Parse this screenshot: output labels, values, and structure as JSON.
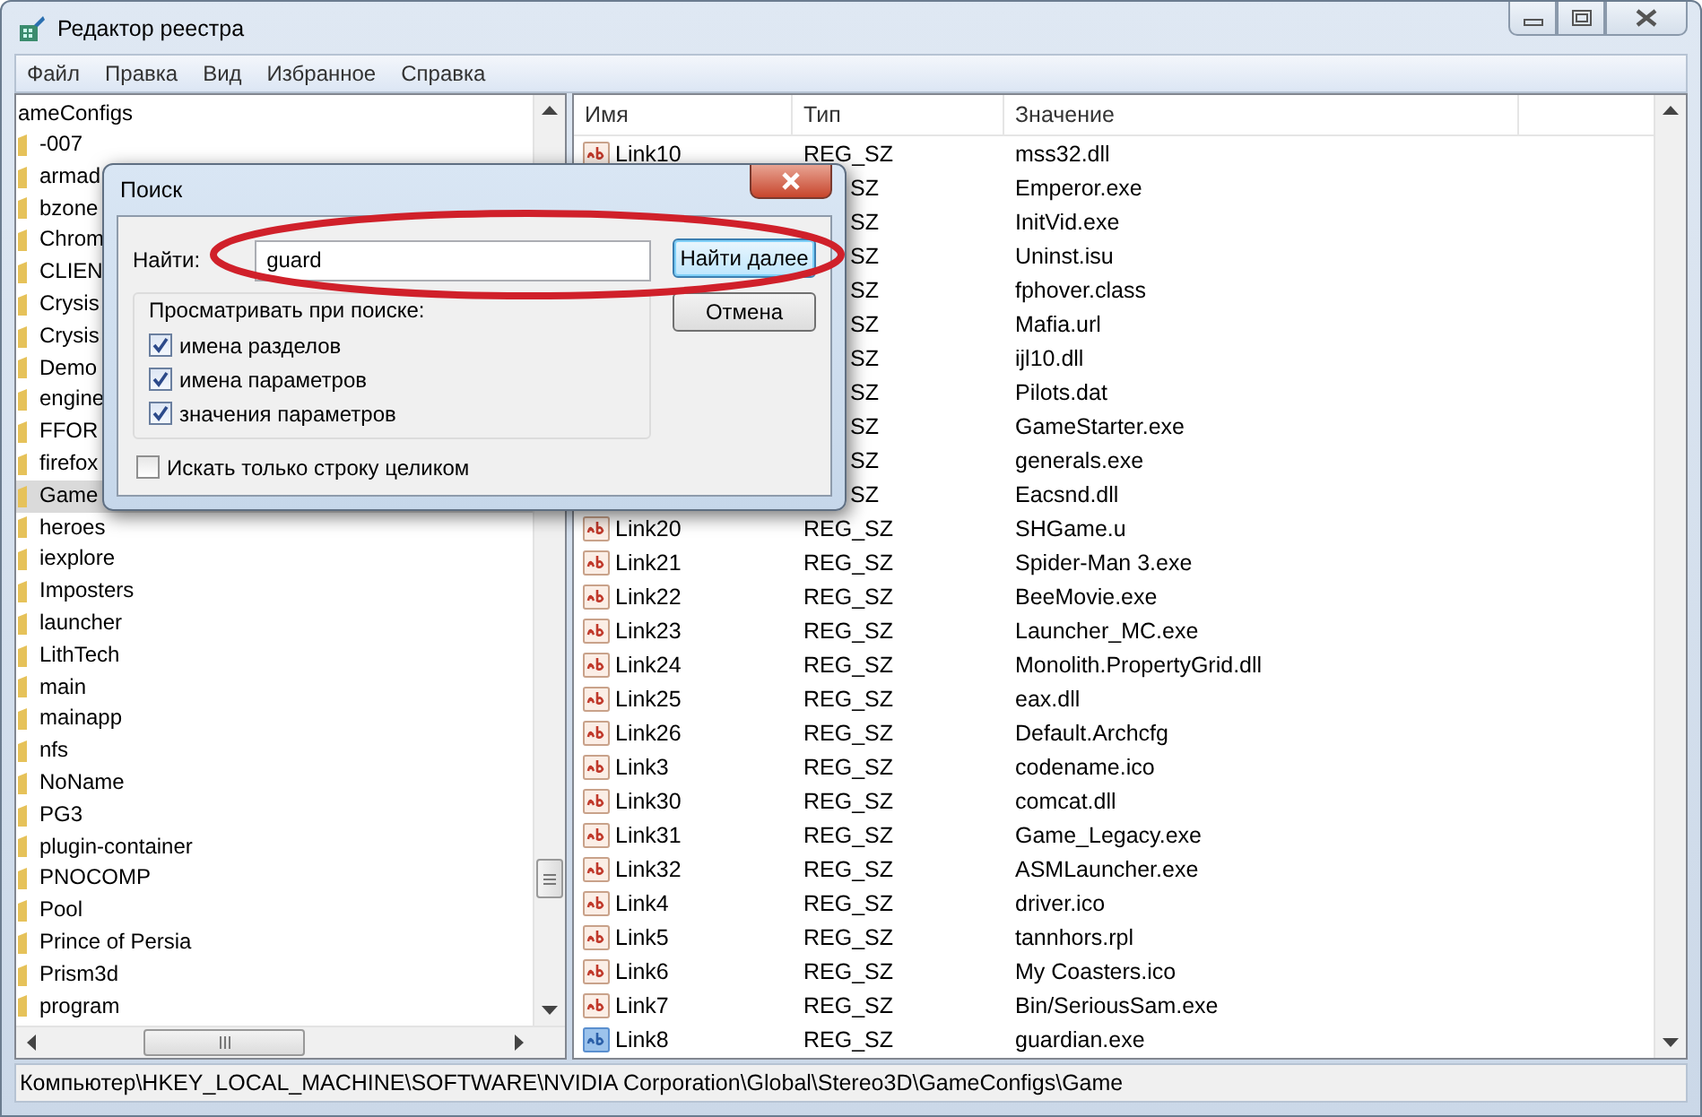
{
  "window": {
    "title": "Редактор реестра"
  },
  "menu": [
    "Файл",
    "Правка",
    "Вид",
    "Избранное",
    "Справка"
  ],
  "tree": {
    "root": "ameConfigs",
    "items": [
      {
        "label": "-007",
        "selected": false
      },
      {
        "label": "armad",
        "selected": false
      },
      {
        "label": "bzone",
        "selected": false
      },
      {
        "label": "Chrom",
        "selected": false
      },
      {
        "label": "CLIEN",
        "selected": false
      },
      {
        "label": "Crysis",
        "selected": false
      },
      {
        "label": "Crysis",
        "selected": false
      },
      {
        "label": "Demo",
        "selected": false
      },
      {
        "label": "engine",
        "selected": false
      },
      {
        "label": "FFOR",
        "selected": false
      },
      {
        "label": "firefox",
        "selected": false
      },
      {
        "label": "Game",
        "selected": true
      },
      {
        "label": "heroes",
        "selected": false
      },
      {
        "label": "iexplore",
        "selected": false
      },
      {
        "label": "Imposters",
        "selected": false
      },
      {
        "label": "launcher",
        "selected": false
      },
      {
        "label": "LithTech",
        "selected": false
      },
      {
        "label": "main",
        "selected": false
      },
      {
        "label": "mainapp",
        "selected": false
      },
      {
        "label": "nfs",
        "selected": false
      },
      {
        "label": "NoName",
        "selected": false
      },
      {
        "label": "PG3",
        "selected": false
      },
      {
        "label": "plugin-container",
        "selected": false
      },
      {
        "label": "PNOCOMP",
        "selected": false
      },
      {
        "label": "Pool",
        "selected": false
      },
      {
        "label": "Prince of Persia",
        "selected": false
      },
      {
        "label": "Prism3d",
        "selected": false
      },
      {
        "label": "program",
        "selected": false
      }
    ]
  },
  "table": {
    "columns": [
      "Имя",
      "Тип",
      "Значение"
    ],
    "rows": [
      {
        "name": "Link10",
        "type": "REG_SZ",
        "value": "mss32.dll",
        "selected": false
      },
      {
        "type": "SZ",
        "value": "Emperor.exe"
      },
      {
        "type": "SZ",
        "value": "InitVid.exe"
      },
      {
        "type": "SZ",
        "value": "Uninst.isu"
      },
      {
        "type": "SZ",
        "value": "fphover.class"
      },
      {
        "type": "SZ",
        "value": "Mafia.url"
      },
      {
        "type": "SZ",
        "value": "ijl10.dll"
      },
      {
        "type": "SZ",
        "value": "Pilots.dat"
      },
      {
        "type": "SZ",
        "value": "GameStarter.exe"
      },
      {
        "type": "SZ",
        "value": "generals.exe"
      },
      {
        "type": "SZ",
        "value": "Eacsnd.dll"
      },
      {
        "name": "Link20",
        "type": "REG_SZ",
        "value": "SHGame.u",
        "selected": false
      },
      {
        "name": "Link21",
        "type": "REG_SZ",
        "value": "Spider-Man 3.exe",
        "selected": false
      },
      {
        "name": "Link22",
        "type": "REG_SZ",
        "value": "BeeMovie.exe",
        "selected": false
      },
      {
        "name": "Link23",
        "type": "REG_SZ",
        "value": "Launcher_MC.exe",
        "selected": false
      },
      {
        "name": "Link24",
        "type": "REG_SZ",
        "value": "Monolith.PropertyGrid.dll",
        "selected": false
      },
      {
        "name": "Link25",
        "type": "REG_SZ",
        "value": "eax.dll",
        "selected": false
      },
      {
        "name": "Link26",
        "type": "REG_SZ",
        "value": "Default.Archcfg",
        "selected": false
      },
      {
        "name": "Link3",
        "type": "REG_SZ",
        "value": "codename.ico",
        "selected": false
      },
      {
        "name": "Link30",
        "type": "REG_SZ",
        "value": "comcat.dll",
        "selected": false
      },
      {
        "name": "Link31",
        "type": "REG_SZ",
        "value": "Game_Legacy.exe",
        "selected": false
      },
      {
        "name": "Link32",
        "type": "REG_SZ",
        "value": "ASMLauncher.exe",
        "selected": false
      },
      {
        "name": "Link4",
        "type": "REG_SZ",
        "value": "driver.ico",
        "selected": false
      },
      {
        "name": "Link5",
        "type": "REG_SZ",
        "value": "tannhors.rpl",
        "selected": false
      },
      {
        "name": "Link6",
        "type": "REG_SZ",
        "value": "My Coasters.ico",
        "selected": false
      },
      {
        "name": "Link7",
        "type": "REG_SZ",
        "value": "Bin/SeriousSam.exe",
        "selected": false
      },
      {
        "name": "Link8",
        "type": "REG_SZ",
        "value": "guardian.exe",
        "selected": true
      }
    ]
  },
  "status_bar": "Компьютер\\HKEY_LOCAL_MACHINE\\SOFTWARE\\NVIDIA Corporation\\Global\\Stereo3D\\GameConfigs\\Game",
  "dialog": {
    "title": "Поиск",
    "find_label": "Найти:",
    "find_value": "guard",
    "buttons": [
      {
        "label": "Найти далее",
        "default": true
      },
      {
        "label": "Отмена",
        "default": false
      }
    ],
    "group_label": "Просматривать при поиске:",
    "options": [
      {
        "label": "имена разделов",
        "checked": true
      },
      {
        "label": "имена параметров",
        "checked": true
      },
      {
        "label": "значения параметров",
        "checked": true
      }
    ],
    "whole_string": {
      "label": "Искать только строку целиком",
      "checked": false
    }
  }
}
